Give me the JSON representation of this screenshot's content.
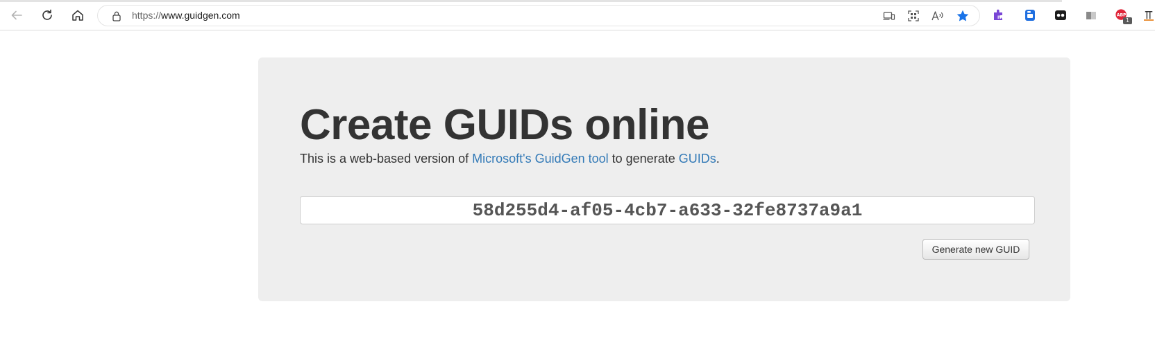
{
  "browser": {
    "url_prefix": "https://",
    "url_host": "www.guidgen.com",
    "icons": {
      "back": "back-arrow-icon",
      "reload": "reload-icon",
      "home": "home-icon",
      "lock": "lock-icon",
      "favorite": "star-icon"
    },
    "extension_badge": "1",
    "accent_colors": {
      "favorite_star": "#1a73e8",
      "ext_purple": "#7a46d6",
      "ext_blue": "#1f6fe0",
      "ext_red": "#e0263a"
    }
  },
  "page": {
    "title": "Create GUIDs online",
    "intro": {
      "text_before": "This is a web-based version of ",
      "link1": "Microsoft's GuidGen tool",
      "text_middle": " to generate ",
      "link2": "GUIDs",
      "text_after": "."
    },
    "guid_value": "58d255d4-af05-4cb7-a633-32fe8737a9a1",
    "generate_button": "Generate new GUID",
    "link_color": "#337ab7",
    "panel_color": "#eeeeee"
  }
}
